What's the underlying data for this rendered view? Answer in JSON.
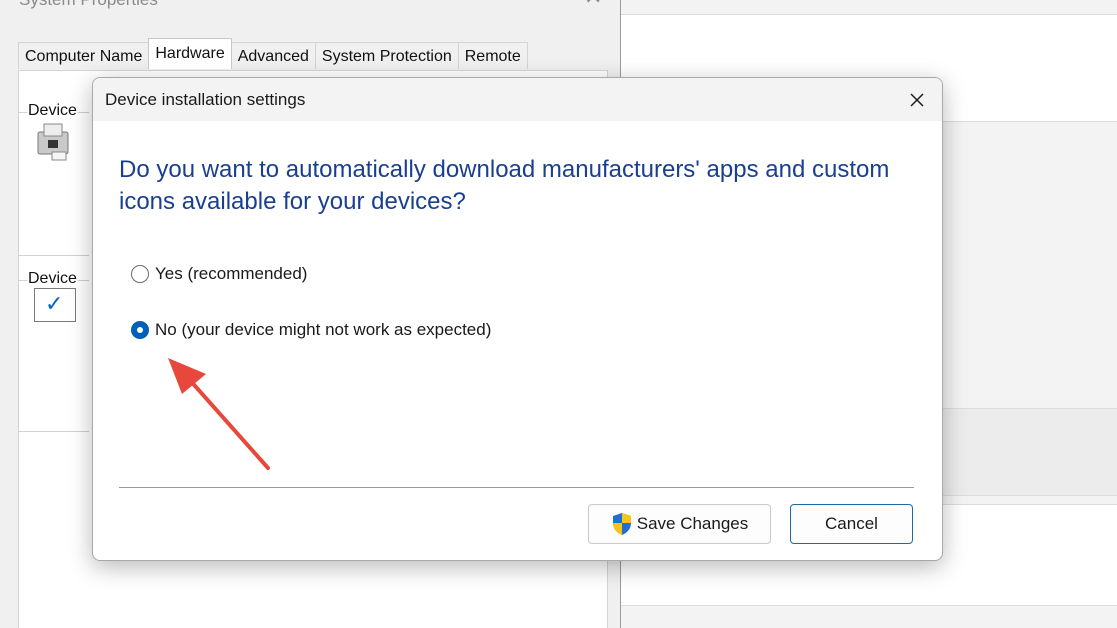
{
  "background_window": {
    "title": "System Properties",
    "tabs": [
      "Computer Name",
      "Hardware",
      "Advanced",
      "System Protection",
      "Remote"
    ],
    "active_tab": "Hardware",
    "group_labels": [
      "Device",
      "Device"
    ]
  },
  "dialog": {
    "title": "Device installation settings",
    "question": "Do you want to automatically download manufacturers' apps and custom icons available for your devices?",
    "options": [
      {
        "label": "Yes (recommended)",
        "selected": false
      },
      {
        "label": "No (your device might not work as expected)",
        "selected": true
      }
    ],
    "buttons": {
      "save_label": "Save Changes",
      "cancel_label": "Cancel"
    }
  },
  "annotation": {
    "arrow_color": "#e8473c"
  },
  "colors": {
    "accent": "#005fb8",
    "question_text": "#1b3f90"
  }
}
